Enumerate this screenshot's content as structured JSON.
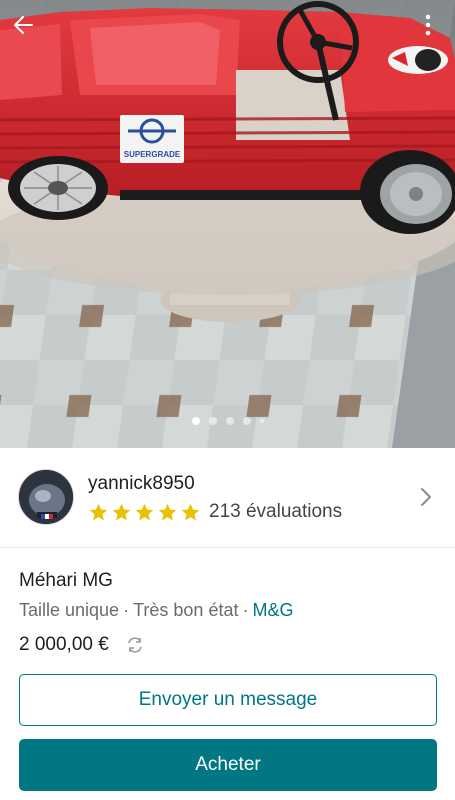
{
  "photo": {
    "image_name": "red-mehari-pedal-car-photo",
    "badge_text": "SUPERGRADE",
    "carousel_count": 5,
    "carousel_active_index": 0
  },
  "header": {
    "back_icon": "back-arrow-icon",
    "more_icon": "more-vertical-icon"
  },
  "seller": {
    "username": "yannick8950",
    "rating_stars": 5,
    "reviews_label": "213 évaluations"
  },
  "item": {
    "title": "Méhari MG",
    "size": "Taille unique",
    "condition": "Très bon état",
    "brand": "M&G",
    "separator": "·",
    "price": "2 000,00 €"
  },
  "actions": {
    "message_label": "Envoyer un message",
    "buy_label": "Acheter"
  },
  "colors": {
    "accent": "#007782",
    "star": "#e8c200",
    "car_red": "#d8262d"
  }
}
